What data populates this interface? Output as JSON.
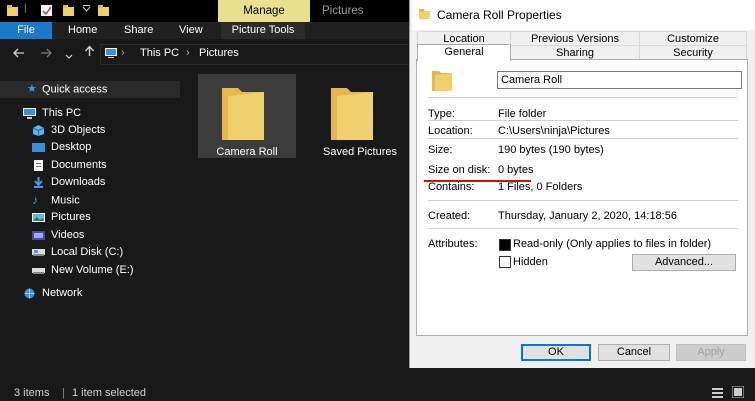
{
  "explorer": {
    "ribbon_context": {
      "manage": "Manage",
      "pictures": "Pictures"
    },
    "ribbon_tabs": [
      "File",
      "Home",
      "Share",
      "View",
      "Picture Tools"
    ],
    "breadcrumb": [
      "This PC",
      "Pictures"
    ],
    "nav_pane": {
      "quick_access": "Quick access",
      "this_pc": "This PC",
      "items": [
        "3D Objects",
        "Desktop",
        "Documents",
        "Downloads",
        "Music",
        "Pictures",
        "Videos",
        "Local Disk (C:)",
        "New Volume (E:)"
      ],
      "network": "Network"
    },
    "folders": [
      "Camera Roll",
      "Saved Pictures"
    ],
    "status": {
      "items": "3 items",
      "selected": "1 item selected"
    }
  },
  "dialog": {
    "title": "Camera Roll Properties",
    "tabs_top": [
      "Location",
      "Previous Versions",
      "Customize"
    ],
    "tabs_bottom": [
      "General",
      "Sharing",
      "Security"
    ],
    "folder_name": "Camera Roll",
    "rows": {
      "type_label": "Type:",
      "type_value": "File folder",
      "location_label": "Location:",
      "location_value": "C:\\Users\\ninja\\Pictures",
      "size_label": "Size:",
      "size_value": "190 bytes (190 bytes)",
      "size_on_disk_label": "Size on disk:",
      "size_on_disk_value": "0 bytes",
      "contains_label": "Contains:",
      "contains_value": "1 Files, 0 Folders",
      "created_label": "Created:",
      "created_value": "Thursday, January 2, 2020, 14:18:56",
      "attributes_label": "Attributes:"
    },
    "attributes": {
      "readonly": "Read-only (Only applies to files in folder)",
      "hidden": "Hidden",
      "advanced": "Advanced...",
      "readonly_checked": true,
      "hidden_checked": false
    },
    "buttons": {
      "ok": "OK",
      "cancel": "Cancel",
      "apply": "Apply"
    }
  },
  "colors": {
    "accent": "#1979ca",
    "manage_tab": "#e9e08f",
    "folder": "#f0cf6e",
    "highlight": "#d01010"
  }
}
